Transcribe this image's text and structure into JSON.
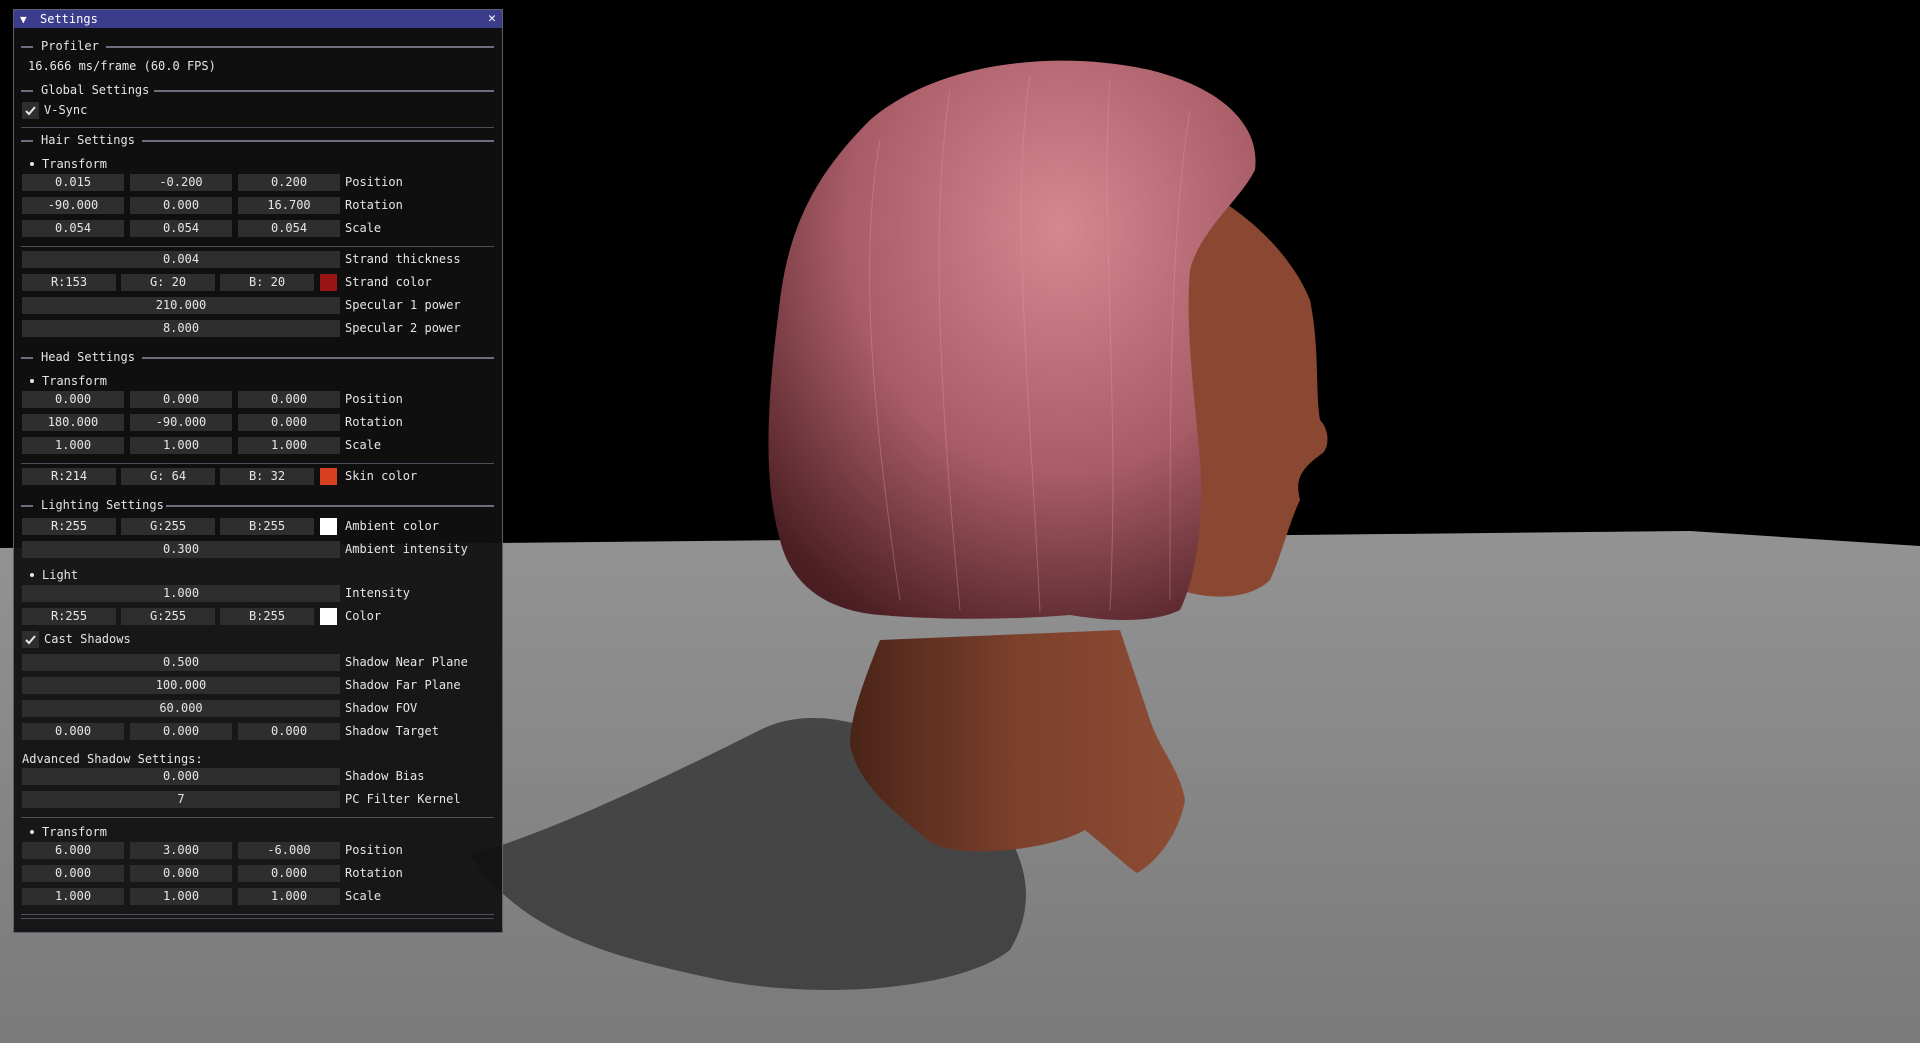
{
  "window": {
    "title": "Settings",
    "collapse_icon": "triangle-down-icon",
    "close_icon": "close-icon"
  },
  "profiler": {
    "header": "Profiler",
    "frame_time": "16.666 ms/frame (60.0 FPS)"
  },
  "global": {
    "header": "Global Settings",
    "vsync_label": "V-Sync",
    "vsync_checked": true
  },
  "hair": {
    "header": "Hair Settings",
    "transform_label": "Transform",
    "position": [
      "0.015",
      "-0.200",
      "0.200"
    ],
    "position_label": "Position",
    "rotation": [
      "-90.000",
      "0.000",
      "16.700"
    ],
    "rotation_label": "Rotation",
    "scale": [
      "0.054",
      "0.054",
      "0.054"
    ],
    "scale_label": "Scale",
    "strand_thickness": "0.004",
    "strand_thickness_label": "Strand thickness",
    "strand_color": [
      "R:153",
      "G: 20",
      "B: 20"
    ],
    "strand_color_hex": "#991414",
    "strand_color_label": "Strand color",
    "spec1": "210.000",
    "spec1_label": "Specular 1 power",
    "spec2": "8.000",
    "spec2_label": "Specular 2 power"
  },
  "head": {
    "header": "Head Settings",
    "transform_label": "Transform",
    "position": [
      "0.000",
      "0.000",
      "0.000"
    ],
    "position_label": "Position",
    "rotation": [
      "180.000",
      "-90.000",
      "0.000"
    ],
    "rotation_label": "Rotation",
    "scale": [
      "1.000",
      "1.000",
      "1.000"
    ],
    "scale_label": "Scale",
    "skin_color": [
      "R:214",
      "G: 64",
      "B: 32"
    ],
    "skin_color_hex": "#d64020",
    "skin_color_label": "Skin color"
  },
  "lighting": {
    "header": "Lighting Settings",
    "ambient_color": [
      "R:255",
      "G:255",
      "B:255"
    ],
    "ambient_color_hex": "#ffffff",
    "ambient_color_label": "Ambient color",
    "ambient_intensity": "0.300",
    "ambient_intensity_label": "Ambient intensity",
    "light_label": "Light",
    "intensity": "1.000",
    "intensity_label": "Intensity",
    "color": [
      "R:255",
      "G:255",
      "B:255"
    ],
    "color_hex": "#ffffff",
    "color_label": "Color",
    "cast_shadows_label": "Cast Shadows",
    "cast_shadows_checked": true,
    "shadow_near": "0.500",
    "shadow_near_label": "Shadow Near Plane",
    "shadow_far": "100.000",
    "shadow_far_label": "Shadow Far Plane",
    "shadow_fov": "60.000",
    "shadow_fov_label": "Shadow FOV",
    "shadow_target": [
      "0.000",
      "0.000",
      "0.000"
    ],
    "shadow_target_label": "Shadow Target",
    "advanced_label": "Advanced Shadow Settings:",
    "shadow_bias": "0.000",
    "shadow_bias_label": "Shadow Bias",
    "pcf_kernel": "7",
    "pcf_kernel_label": "PC Filter Kernel",
    "transform_label": "Transform",
    "position": [
      "6.000",
      "3.000",
      "-6.000"
    ],
    "position_label": "Position",
    "rotation": [
      "0.000",
      "0.000",
      "0.000"
    ],
    "rotation_label": "Rotation",
    "scale": [
      "1.000",
      "1.000",
      "1.000"
    ],
    "scale_label": "Scale"
  },
  "colors": {
    "title_bar": "#3c3c8c",
    "window_bg": "#101010",
    "field_bg": "#2e2e2e",
    "floor": "#8a8a8a",
    "sky": "#000000",
    "hair": "#b86a72",
    "skin": "#7a3f2c"
  }
}
